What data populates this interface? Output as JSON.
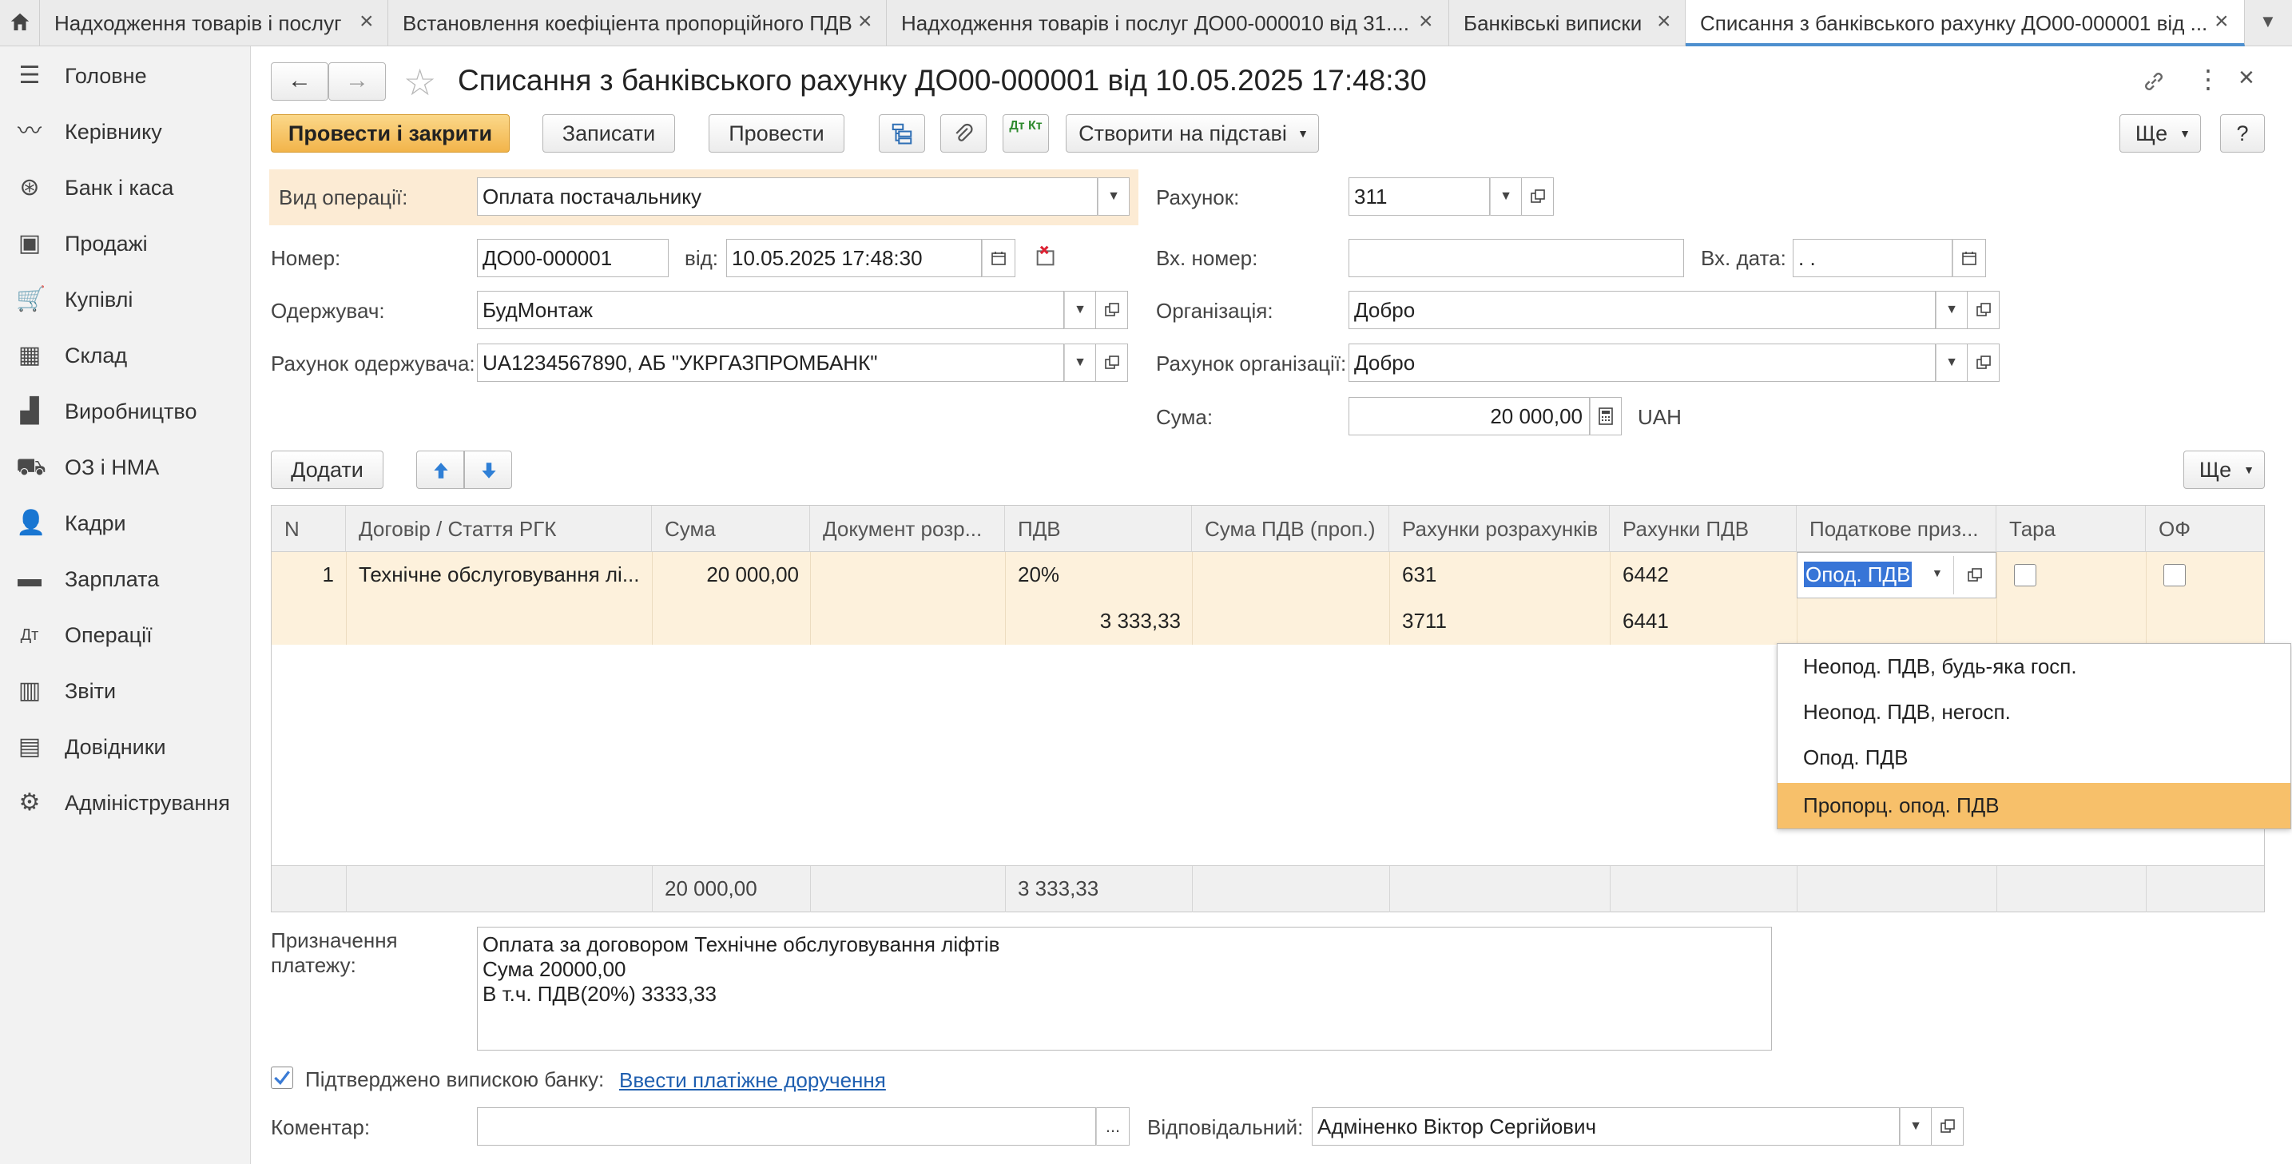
{
  "tabs": [
    {
      "label": "Надходження товарів і послуг"
    },
    {
      "label": "Встановлення коефіціента пропорційного ПДВ"
    },
    {
      "label": "Надходження товарів і послуг ДО00-000010 від 31...."
    },
    {
      "label": "Банківські виписки"
    },
    {
      "label": "Списання з банківського рахунку ДО00-000001 від ..."
    }
  ],
  "sidebar": {
    "items": [
      {
        "label": "Головне",
        "icon": "menu-icon"
      },
      {
        "label": "Керівнику",
        "icon": "trend-chart-icon"
      },
      {
        "label": "Банк і каса",
        "icon": "coin-icon"
      },
      {
        "label": "Продажі",
        "icon": "shopping-bag-icon"
      },
      {
        "label": "Купівлі",
        "icon": "cart-icon"
      },
      {
        "label": "Склад",
        "icon": "warehouse-icon"
      },
      {
        "label": "Виробництво",
        "icon": "factory-icon"
      },
      {
        "label": "ОЗ і НМА",
        "icon": "truck-icon"
      },
      {
        "label": "Кадри",
        "icon": "person-icon"
      },
      {
        "label": "Зарплата",
        "icon": "card-icon"
      },
      {
        "label": "Операції",
        "icon": "debit-credit-icon"
      },
      {
        "label": "Звіти",
        "icon": "bar-chart-icon"
      },
      {
        "label": "Довідники",
        "icon": "books-icon"
      },
      {
        "label": "Адміністрування",
        "icon": "gear-icon"
      }
    ]
  },
  "header": {
    "title": "Списання з банківського рахунку ДО00-000001 від 10.05.2025 17:48:30"
  },
  "toolbar": {
    "post_close": "Провести і закрити",
    "save": "Записати",
    "post": "Провести",
    "dt_kt": "Дт Кт",
    "create_based": "Створити на підставі",
    "more": "Ще",
    "help": "?"
  },
  "form": {
    "op_type_label": "Вид операції:",
    "op_type_value": "Оплата постачальнику",
    "account_label": "Рахунок:",
    "account_value": "311",
    "number_label": "Номер:",
    "number_value": "ДО00-000001",
    "from_label": "від:",
    "date_value": "10.05.2025 17:48:30",
    "in_number_label": "Вх. номер:",
    "in_number_value": "",
    "in_date_label": "Вх. дата:",
    "in_date_value": " .  .",
    "recipient_label": "Одержувач:",
    "recipient_value": "БудМонтаж",
    "org_label": "Організація:",
    "org_value": "Добро",
    "recipient_account_label": "Рахунок одержувача:",
    "recipient_account_value": "UA1234567890, АБ \"УКРГАЗПРОМБАНК\"",
    "org_account_label": "Рахунок організації:",
    "org_account_value": "Добро",
    "sum_label": "Сума:",
    "sum_value": "20 000,00",
    "currency": "UAH"
  },
  "table_toolbar": {
    "add": "Додати",
    "more": "Ще"
  },
  "table": {
    "columns": [
      "N",
      "Договір / Стаття РГК",
      "Сума",
      "Документ розр...",
      "ПДВ",
      "Сума ПДВ (проп.)",
      "Рахунки розрахунків",
      "Рахунки ПДВ",
      "Податкове приз...",
      "Тара",
      "ОФ"
    ],
    "row": {
      "n": "1",
      "contract": "Технічне обслуговування лі...",
      "sum": "20 000,00",
      "doc": "",
      "vat_rate": "20%",
      "vat_sum": "3 333,33",
      "vat_prop": "",
      "acc1": "631",
      "acc2": "3711",
      "vat_acc1": "6442",
      "vat_acc2": "6441",
      "tax_attr": "Опод. ПДВ"
    },
    "totals": {
      "sum": "20 000,00",
      "vat": "3 333,33"
    }
  },
  "dropdown": {
    "options": [
      "Неопод. ПДВ, будь-яка госп.",
      "Неопод. ПДВ, негосп.",
      "Опод. ПДВ",
      "Пропорц. опод. ПДВ"
    ],
    "highlighted": "Пропорц. опод. ПДВ"
  },
  "purpose": {
    "label": "Призначення платежу:",
    "lines": [
      "Оплата за договором Технічне обслуговування ліфтів",
      "Сума 20000,00",
      "В т.ч. ПДВ(20%) 3333,33"
    ]
  },
  "confirm": {
    "label": "Підтверджено випискою банку:",
    "link": "Ввести платіжне доручення"
  },
  "comment": {
    "label": "Коментар:",
    "value": "",
    "more": "..."
  },
  "responsible": {
    "label": "Відповідальний:",
    "value": "Адміненко Віктор Сергійович"
  },
  "colors": {
    "accent": "#f2b44a",
    "highlight_row": "#fdf1dc",
    "selection": "#f7c06a",
    "link": "#1f5fb0"
  }
}
